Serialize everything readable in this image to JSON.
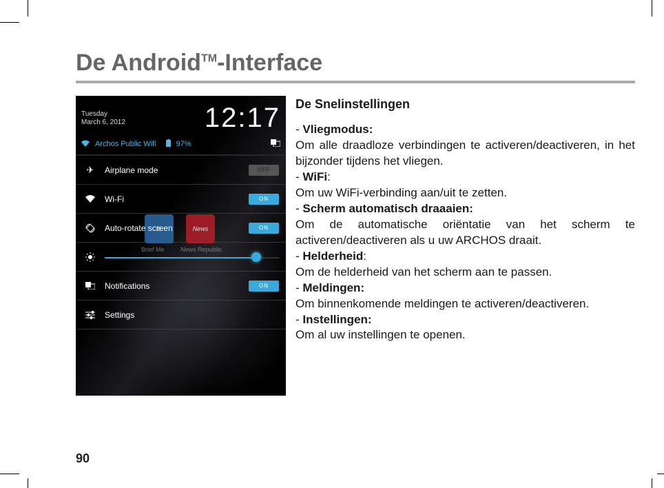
{
  "page_number": "90",
  "title_prefix": "De Android",
  "title_tm": "TM",
  "title_suffix": "-Interface",
  "text": {
    "heading": "De Snelinstellingen",
    "items": [
      {
        "dash": "- ",
        "label": "Vliegmodus:",
        "desc": "Om alle draadloze verbindingen te activeren/deactiveren, in het bijzonder tijdens het vliegen."
      },
      {
        "dash": "- ",
        "label": "WiFi",
        "desc": "Om uw WiFi-verbinding aan/uit te zetten."
      },
      {
        "dash": "- ",
        "label": "Scherm automatisch draaaien:",
        "desc": "Om de automatische oriëntatie van het scherm te activeren/deactiveren als u uw ARCHOS draait."
      },
      {
        "dash": "- ",
        "label": "Helderheid",
        "desc": "Om de helderheid van het scherm aan te passen."
      },
      {
        "dash": "- ",
        "label": "Meldingen:",
        "desc": "Om binnenkomende meldingen te activeren/deactiveren."
      },
      {
        "dash": "- ",
        "label": "Instellingen:",
        "desc": "Om al uw instellingen te openen."
      }
    ]
  },
  "phone": {
    "day": "Tuesday",
    "date": "March 6, 2012",
    "clock": "12:17",
    "wifi_name": "Archos Public Wifi",
    "battery": "97%",
    "rows": {
      "airplane": "Airplane mode",
      "wifi": "Wi-Fi",
      "rotate": "Auto-rotate screen",
      "notifications": "Notifications",
      "settings": "Settings"
    },
    "toggle_off": "OFF",
    "toggle_on": "ON",
    "bg_tiles": {
      "a": "b",
      "b": "News"
    },
    "bg_labels": {
      "a": "Brief Me",
      "b": "News Republic"
    }
  }
}
